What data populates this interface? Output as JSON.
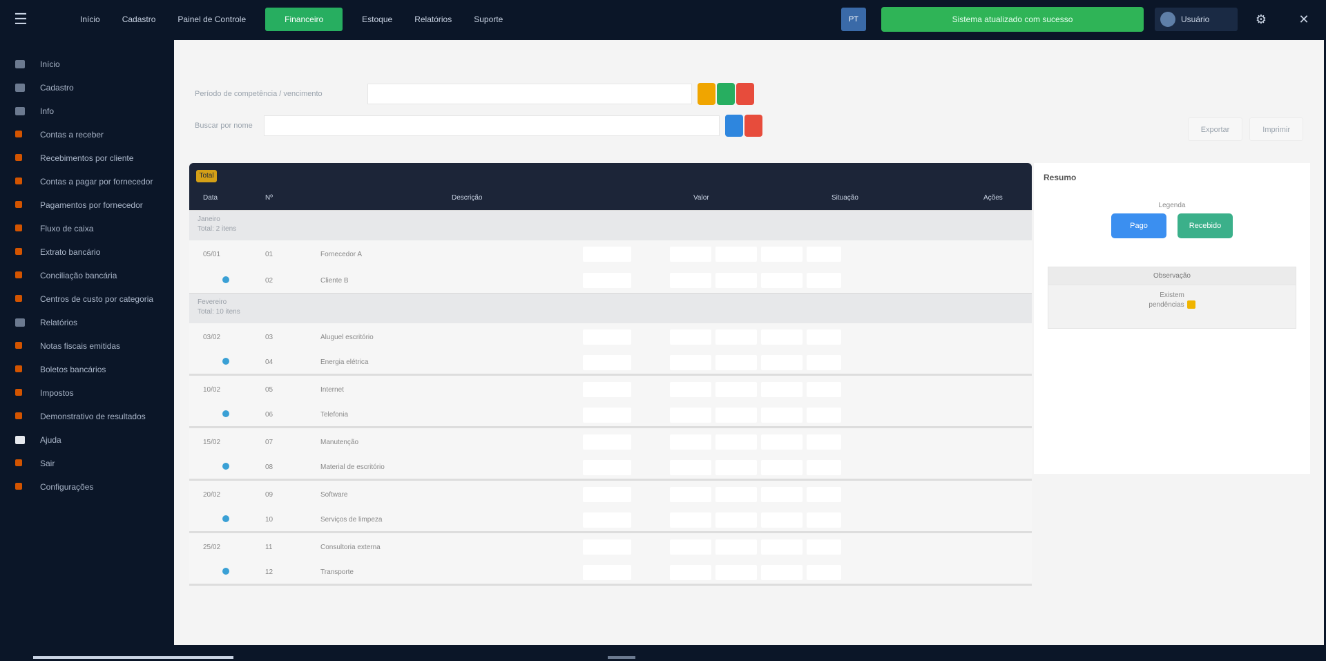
{
  "topbar": {
    "menu_icon": "hamburger-icon",
    "nav": [
      "Início",
      "Cadastro",
      "Painel de Controle",
      "Financeiro",
      "Estoque",
      "Relatórios",
      "Suporte"
    ],
    "active_nav_index": 3,
    "lang": "PT",
    "banner": "Sistema atualizado com sucesso",
    "user": "Usuário",
    "gear_icon": "gear-icon",
    "close_icon": "close-icon"
  },
  "sidebar": {
    "items": [
      {
        "label": "Início",
        "dot": "grey"
      },
      {
        "label": "Cadastro",
        "dot": "grey"
      },
      {
        "label": "Info",
        "dot": "grey"
      },
      {
        "label": "Contas a receber",
        "dot": "orange"
      },
      {
        "label": "Recebimentos por cliente",
        "dot": "orange"
      },
      {
        "label": "Contas a pagar por fornecedor",
        "dot": "orange"
      },
      {
        "label": "Pagamentos por fornecedor",
        "dot": "orange"
      },
      {
        "label": "Fluxo de caixa",
        "dot": "orange"
      },
      {
        "label": "Extrato bancário",
        "dot": "orange"
      },
      {
        "label": "Conciliação bancária",
        "dot": "orange"
      },
      {
        "label": "Centros de custo por categoria",
        "dot": "orange"
      },
      {
        "label": "Relatórios",
        "dot": "grey"
      },
      {
        "label": "Notas fiscais emitidas",
        "dot": "orange"
      },
      {
        "label": "Boletos bancários",
        "dot": "orange"
      },
      {
        "label": "Impostos",
        "dot": "orange"
      },
      {
        "label": "Demonstrativo de resultados",
        "dot": "orange"
      },
      {
        "label": "Ajuda",
        "dot": "white"
      },
      {
        "label": "Sair",
        "dot": "orange"
      },
      {
        "label": "Configurações",
        "dot": "orange"
      }
    ]
  },
  "filters": {
    "row1_label": "Período de competência / vencimento",
    "row1_placeholder": "",
    "row2_label": "Buscar por nome",
    "row2_placeholder": ""
  },
  "top_actions": {
    "export": "Exportar",
    "print": "Imprimir"
  },
  "table": {
    "badge": "Total",
    "columns": [
      "Data",
      "Nº",
      "Descrição",
      "Valor",
      "Situação",
      "Ações"
    ],
    "groups": [
      {
        "title": "Janeiro",
        "subtitle": "Total: 2 itens",
        "rows": [
          {
            "date": "05/01",
            "num": "01",
            "desc": "Fornecedor A"
          },
          {
            "date": "",
            "num": "02",
            "desc": "Cliente B"
          }
        ]
      },
      {
        "title": "Fevereiro",
        "subtitle": "Total: 10 itens",
        "rows": [
          {
            "date": "03/02",
            "num": "03",
            "desc": "Aluguel escritório"
          },
          {
            "date": "",
            "num": "04",
            "desc": "Energia elétrica"
          },
          {
            "date": "10/02",
            "num": "05",
            "desc": "Internet"
          },
          {
            "date": "",
            "num": "06",
            "desc": "Telefonia"
          },
          {
            "date": "15/02",
            "num": "07",
            "desc": "Manutenção"
          },
          {
            "date": "",
            "num": "08",
            "desc": "Material de escritório"
          },
          {
            "date": "20/02",
            "num": "09",
            "desc": "Software"
          },
          {
            "date": "",
            "num": "10",
            "desc": "Serviços de limpeza"
          },
          {
            "date": "25/02",
            "num": "11",
            "desc": "Consultoria externa"
          },
          {
            "date": "",
            "num": "12",
            "desc": "Transporte"
          }
        ]
      }
    ]
  },
  "panel": {
    "title": "Resumo",
    "card_label": "Legenda",
    "btn_blue": "Pago",
    "btn_green": "Recebido",
    "box_header": "Observação",
    "box_text_1": "Existem",
    "box_text_2": "pendências",
    "warn_icon": "warning-icon"
  },
  "colors": {
    "bg_dark": "#0b1628",
    "active_green": "#27ae60",
    "banner_green": "#2fb457",
    "blue": "#3b8ff0",
    "teal": "#3bb08a"
  }
}
